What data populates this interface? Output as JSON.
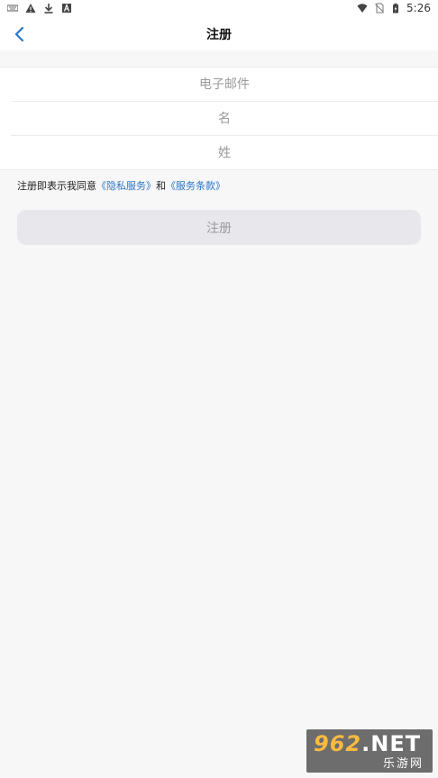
{
  "status_bar": {
    "time": "5:26",
    "left_icons": [
      "keyboard-icon",
      "warning-icon",
      "download-icon",
      "font-icon"
    ],
    "right_icons": [
      "wifi-icon",
      "no-sim-icon",
      "battery-charging-icon"
    ]
  },
  "nav": {
    "back_icon": "chevron-left-icon",
    "title": "注册"
  },
  "form": {
    "email_placeholder": "电子邮件",
    "first_name_placeholder": "名",
    "last_name_placeholder": "姓"
  },
  "agreement": {
    "prefix": "注册即表示我同意",
    "privacy_link": "《隐私服务》",
    "conjunction": "和",
    "terms_link": "《服务条款》"
  },
  "register_button": {
    "label": "注册"
  },
  "watermark": {
    "number": "962",
    "domain": ".NET",
    "site_name": "乐游网"
  },
  "colors": {
    "accent": "#2a76c8",
    "background": "#f7f7f8",
    "button_disabled_bg": "#e8e8ec",
    "button_disabled_text": "#9b9b9f"
  }
}
